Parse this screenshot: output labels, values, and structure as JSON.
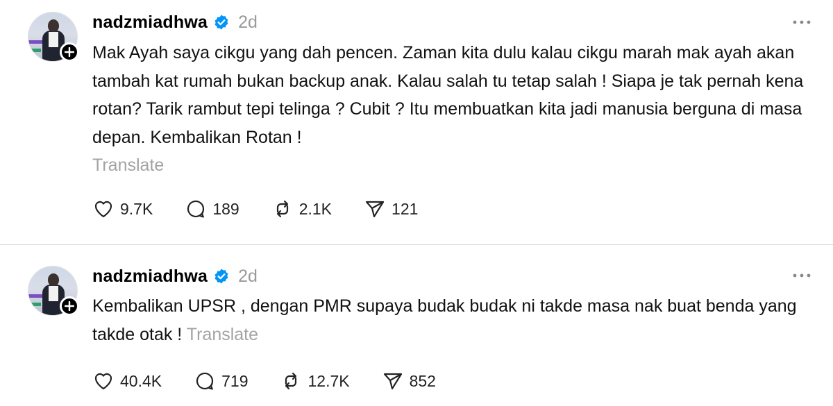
{
  "posts": [
    {
      "username": "nadzmiadhwa",
      "time": "2d",
      "text": "Mak Ayah saya cikgu yang dah pencen. Zaman kita dulu kalau cikgu marah mak ayah akan tambah kat rumah bukan backup anak. Kalau salah tu tetap salah ! Siapa je tak pernah kena rotan? Tarik rambut tepi telinga ? Cubit ? Itu membuatkan kita jadi manusia berguna di masa depan. Kembalikan Rotan !",
      "translate": "Translate",
      "likes": "9.7K",
      "replies": "189",
      "reposts": "2.1K",
      "shares": "121"
    },
    {
      "username": "nadzmiadhwa",
      "time": "2d",
      "text": "Kembalikan UPSR , dengan PMR supaya budak budak ni takde masa nak buat benda yang takde otak ! ",
      "translate": "Translate",
      "likes": "40.4K",
      "replies": "719",
      "reposts": "12.7K",
      "shares": "852"
    }
  ],
  "icons": {
    "verified": "verified-badge-icon",
    "follow": "plus-icon",
    "more": "more-horizontal-icon",
    "like": "heart-icon",
    "reply": "comment-bubble-icon",
    "repost": "repost-icon",
    "share": "send-icon"
  },
  "colors": {
    "verified": "#0095f6",
    "muted": "#9a9a9a",
    "divider": "#dcdcdc"
  }
}
